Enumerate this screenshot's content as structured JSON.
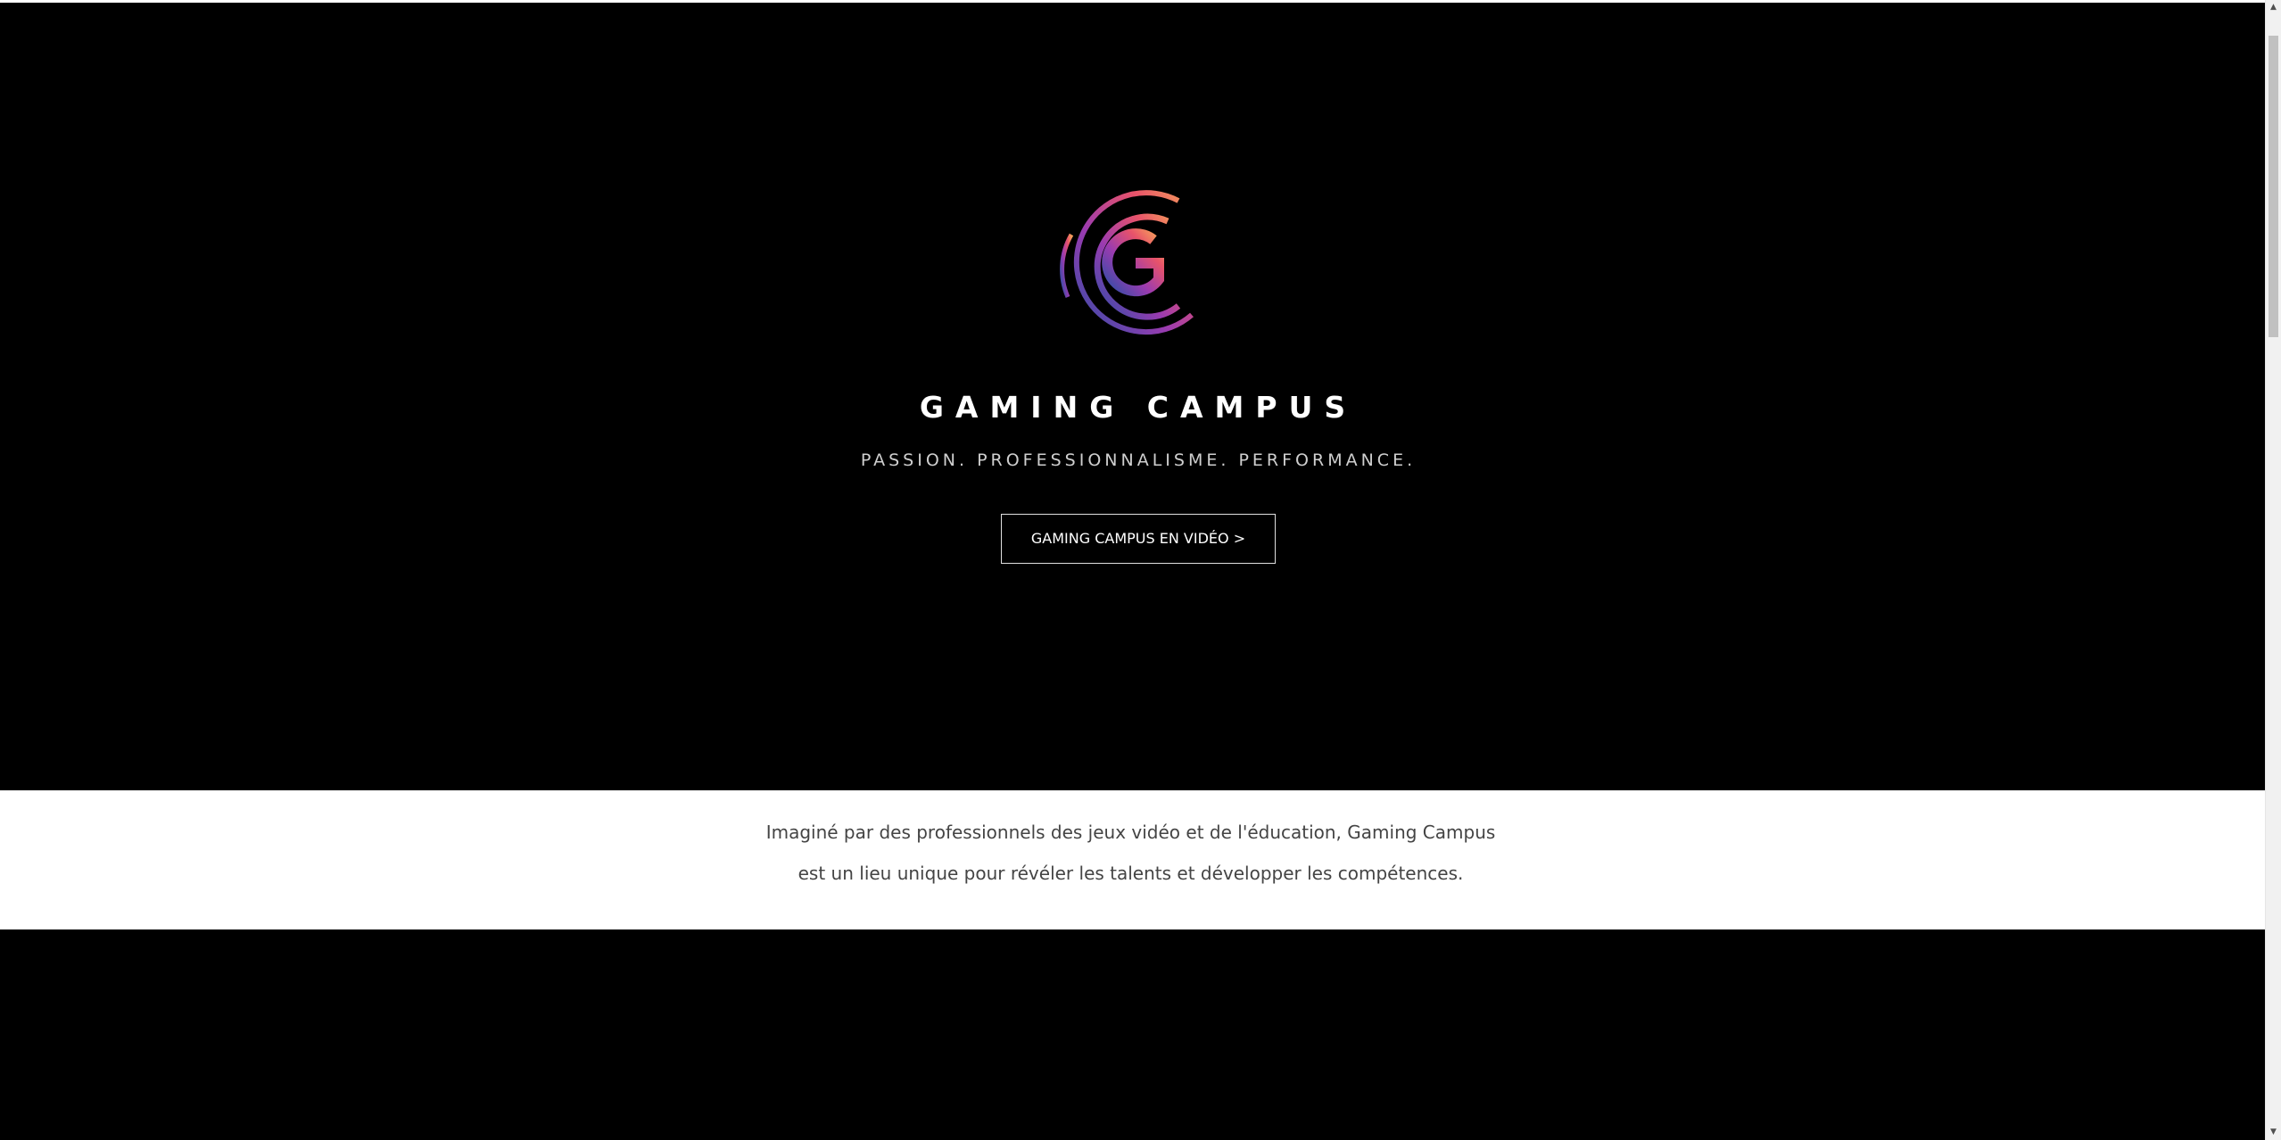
{
  "hero": {
    "logo_icon": "gaming-campus-g-logo",
    "title": "GAMING CAMPUS",
    "tagline": "PASSION. PROFESSIONNALISME. PERFORMANCE.",
    "video_button_label": "GAMING CAMPUS EN VIDÉO >"
  },
  "intro": {
    "line1": "Imaginé par des professionnels des jeux vidéo et de l'éducation, Gaming Campus",
    "line2": "est un lieu unique pour révéler les talents et développer les compétences."
  },
  "colors": {
    "logo_gradient": [
      "#2e4ea6",
      "#9b3bb0",
      "#e8536a",
      "#f6a15a"
    ],
    "background": "#000000",
    "intro_background": "#ffffff"
  },
  "scrollbar": {
    "up_icon": "scroll-up-arrow",
    "down_icon": "scroll-down-arrow"
  }
}
